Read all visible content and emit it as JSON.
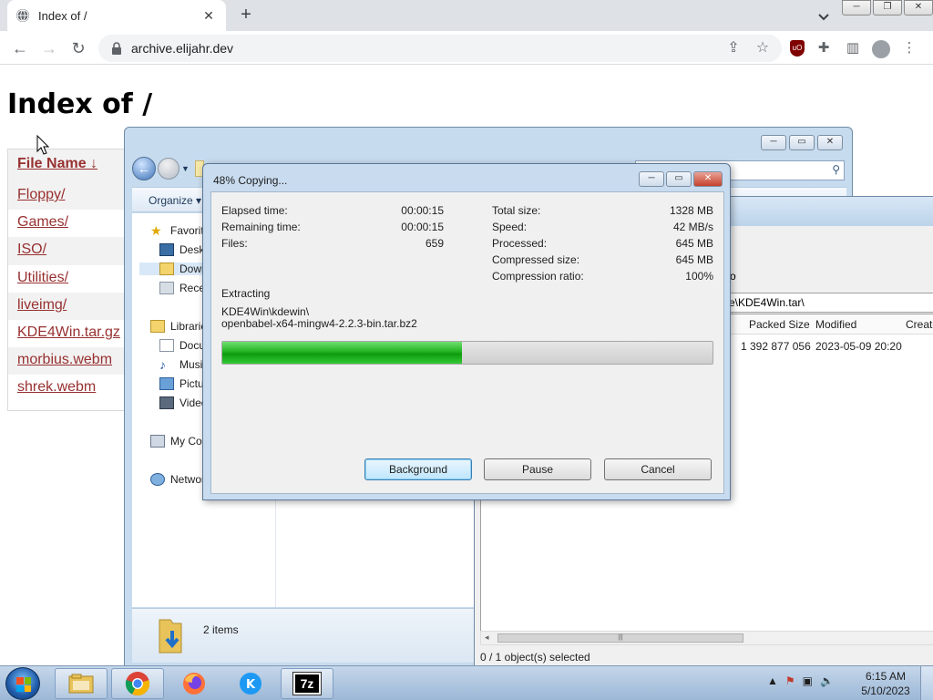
{
  "browser": {
    "tab_title": "Index of /",
    "tab_close": "✕",
    "new_tab": "+",
    "url": "archive.elijahr.dev"
  },
  "page": {
    "heading": "Index of /",
    "table": {
      "header": "File Name  ↓",
      "rows": [
        "Floppy/",
        "Games/",
        "ISO/",
        "Utilities/",
        "liveimg/",
        "KDE4Win.tar.gz",
        "morbius.webm",
        "shrek.webm"
      ]
    }
  },
  "explorer": {
    "organize": "Organize ▾",
    "nav": {
      "favorites": "Favorit",
      "desktop": "Deskt",
      "downloads": "Down",
      "recent": "Recen",
      "libraries": "Librarie",
      "documents": "Docu",
      "music": "Musi",
      "pictures": "Pictu",
      "videos": "Video",
      "computer": "My Co",
      "network": "Networ"
    },
    "item_count": "2 items"
  },
  "sevenzip": {
    "toolbar_fragment": "o",
    "path": "e\\KDE4Win.tar\\",
    "columns": [
      "Packed Size",
      "Modified",
      "Create"
    ],
    "row": {
      "packed_size": "1 392 877 056",
      "modified": "2023-05-09 20:20"
    },
    "status": "0 / 1 object(s) selected"
  },
  "dialog": {
    "title": "48% Copying...",
    "progress_fraction": 0.488,
    "left_stats": [
      {
        "label": "Elapsed time:",
        "value": "00:00:15"
      },
      {
        "label": "Remaining time:",
        "value": "00:00:15"
      },
      {
        "label": "Files:",
        "value": "659"
      }
    ],
    "right_stats": [
      {
        "label": "Total size:",
        "value": "1328 MB"
      },
      {
        "label": "Speed:",
        "value": "42 MB/s"
      },
      {
        "label": "Processed:",
        "value": "645 MB"
      },
      {
        "label": "Compressed size:",
        "value": "645 MB"
      },
      {
        "label": "Compression ratio:",
        "value": "100%"
      }
    ],
    "operation": "Extracting",
    "current_path_line1": "KDE4Win\\kdewin\\",
    "current_path_line2": "openbabel-x64-mingw4-2.2.3-bin.tar.bz2",
    "buttons": {
      "background": "Background",
      "pause": "Pause",
      "cancel": "Cancel"
    }
  },
  "taskbar": {
    "time": "6:15 AM",
    "date": "5/10/2023",
    "seven_zip_label": "7z"
  },
  "colors": {
    "link": "#983030",
    "progress_green": "#22b322",
    "aero_frame": "#c9dcef"
  }
}
